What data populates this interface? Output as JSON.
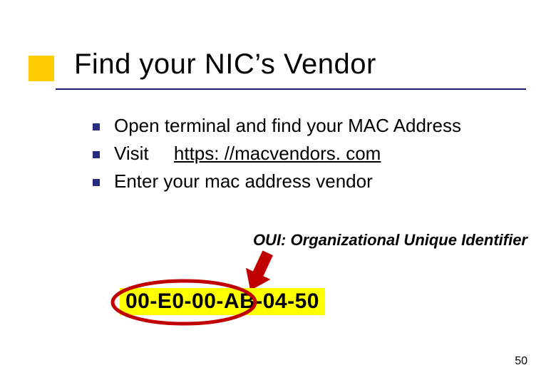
{
  "title": "Find your NIC’s Vendor",
  "bullets": [
    {
      "text": "Open terminal and find your MAC Address"
    },
    {
      "prefix": "Visit",
      "link": "https: //macvendors. com"
    },
    {
      "text": "Enter your mac address vendor"
    }
  ],
  "oui": {
    "acronym": "OUI:",
    "expansion": "Organizational Unique Identifier"
  },
  "mac": "00-E0-00-AB-04-50",
  "pageNumber": "50",
  "colors": {
    "accent": "#ffcc00",
    "rule": "#1c1c6e",
    "bullet": "#2a2a80",
    "highlight": "#ffff00",
    "arrow": "#c00000",
    "ellipse": "#c00000"
  }
}
